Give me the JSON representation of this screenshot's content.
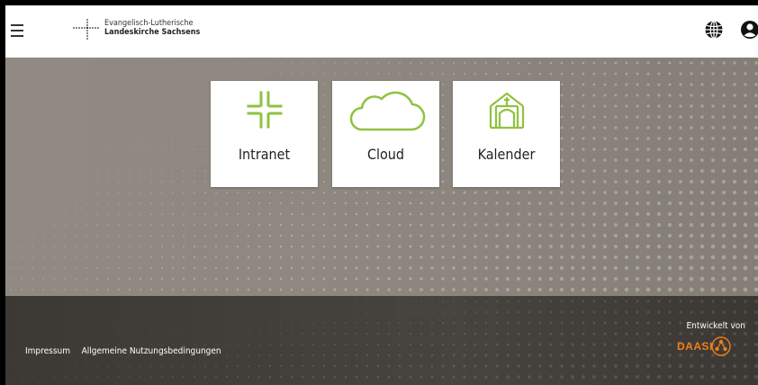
{
  "header": {
    "logo_line1": "Evangelisch-Lutherische",
    "logo_line2": "Landeskirche Sachsens",
    "menu_icon": "hamburger-icon",
    "language_icon": "globe-icon",
    "user_icon": "user-icon"
  },
  "tiles": [
    {
      "label": "Intranet",
      "icon": "intranet-cross-icon"
    },
    {
      "label": "Cloud",
      "icon": "cloud-icon"
    },
    {
      "label": "Kalender",
      "icon": "church-calendar-icon"
    }
  ],
  "footer": {
    "links": [
      "Impressum",
      "Allgemeine Nutzungsbedingungen"
    ],
    "developed_by": "Entwickelt von",
    "developer_logo": "DAASI"
  },
  "colors": {
    "accent_green": "#8fc23f",
    "daasi_orange": "#f07d1a"
  }
}
